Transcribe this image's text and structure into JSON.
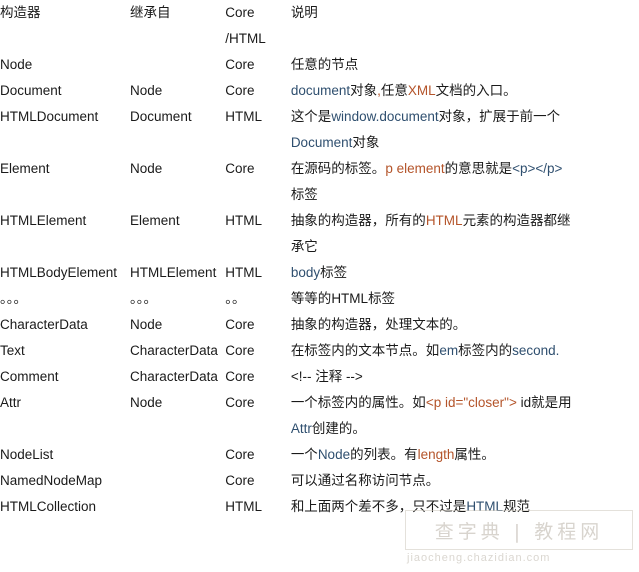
{
  "page": {
    "title": "DOM 构造器继承关系表",
    "background": "#ffffff",
    "text_color": "#1a1a1a",
    "code_blue": "#2f4f6f",
    "code_orange": "#b4542a"
  },
  "table": {
    "headers": {
      "constructor": "构造器",
      "inherits": "继承自",
      "module_line1": "Core",
      "module_line2": "/HTML",
      "description": "说明"
    },
    "rows": [
      {
        "constructor": "Node",
        "inherits": "",
        "module": "Core",
        "desc_lines": [
          [
            {
              "t": "任意的节点",
              "k": "plain"
            }
          ]
        ]
      },
      {
        "constructor": "Document",
        "inherits": "Node",
        "module": "Core",
        "desc_lines": [
          [
            {
              "t": "document",
              "k": "blue"
            },
            {
              "t": "对象",
              "k": "plain"
            },
            {
              "t": ",",
              "k": "orange"
            },
            {
              "t": "任意",
              "k": "plain"
            },
            {
              "t": "XML",
              "k": "orange"
            },
            {
              "t": "文档的入口。",
              "k": "plain"
            }
          ]
        ]
      },
      {
        "constructor": "HTMLDocument",
        "inherits": "Document",
        "module": "HTML",
        "desc_lines": [
          [
            {
              "t": "这个是",
              "k": "plain"
            },
            {
              "t": "window.document",
              "k": "blue"
            },
            {
              "t": "对象，扩展于前一个",
              "k": "plain"
            }
          ],
          [
            {
              "t": "Document",
              "k": "blue"
            },
            {
              "t": "对象",
              "k": "plain"
            }
          ]
        ]
      },
      {
        "constructor": "Element",
        "inherits": "Node",
        "module": "Core",
        "desc_lines": [
          [
            {
              "t": "在源码的标签。",
              "k": "plain"
            },
            {
              "t": "p element",
              "k": "orange"
            },
            {
              "t": "的意思就是",
              "k": "plain"
            },
            {
              "t": "<p></p>",
              "k": "blue"
            }
          ],
          [
            {
              "t": "标签",
              "k": "plain"
            }
          ]
        ]
      },
      {
        "constructor": "HTMLElement",
        "inherits": "Element",
        "module": "HTML",
        "desc_lines": [
          [
            {
              "t": "抽象的构造器，所有的",
              "k": "plain"
            },
            {
              "t": "HTML",
              "k": "orange"
            },
            {
              "t": "元素的构造器都继",
              "k": "plain"
            }
          ],
          [
            {
              "t": "承它",
              "k": "plain"
            }
          ]
        ]
      },
      {
        "constructor": "HTMLBodyElement",
        "inherits": "HTMLElement",
        "module": "HTML",
        "desc_lines": [
          [
            {
              "t": "body",
              "k": "blue"
            },
            {
              "t": "标签",
              "k": "plain"
            }
          ]
        ]
      },
      {
        "constructor": "。。。",
        "inherits": "。。。",
        "module": "。。",
        "desc_lines": [
          [
            {
              "t": "等等的",
              "k": "plain"
            },
            {
              "t": "HTML",
              "k": "plain"
            },
            {
              "t": "标签",
              "k": "plain"
            }
          ]
        ]
      },
      {
        "constructor": "CharacterData",
        "inherits": "Node",
        "module": "Core",
        "desc_lines": [
          [
            {
              "t": "抽象的构造器，处理文本的。",
              "k": "plain"
            }
          ]
        ]
      },
      {
        "constructor": "Text",
        "inherits": "CharacterData",
        "module": "Core",
        "desc_lines": [
          [
            {
              "t": "在标签内的文本节点。如",
              "k": "plain"
            },
            {
              "t": "em",
              "k": "blue"
            },
            {
              "t": "标签内的",
              "k": "plain"
            },
            {
              "t": "second.",
              "k": "blue"
            }
          ]
        ]
      },
      {
        "constructor": "Comment",
        "inherits": "CharacterData",
        "module": "Core",
        "desc_lines": [
          [
            {
              "t": "<!-- 注释 -->",
              "k": "plain"
            }
          ]
        ]
      },
      {
        "constructor": "Attr",
        "inherits": "Node",
        "module": "Core",
        "desc_lines": [
          [
            {
              "t": "一个标签内的属性。如",
              "k": "plain"
            },
            {
              "t": "<p id=\"closer\">",
              "k": "orange"
            },
            {
              "t": " id",
              "k": "plain"
            },
            {
              "t": "就是用",
              "k": "plain"
            }
          ],
          [
            {
              "t": "Attr",
              "k": "blue"
            },
            {
              "t": "创建的。",
              "k": "plain"
            }
          ]
        ]
      },
      {
        "constructor": "NodeList",
        "inherits": "",
        "module": "Core",
        "desc_lines": [
          [
            {
              "t": "一个",
              "k": "plain"
            },
            {
              "t": "Node",
              "k": "blue"
            },
            {
              "t": "的列表。有",
              "k": "plain"
            },
            {
              "t": "length",
              "k": "orange"
            },
            {
              "t": "属性。",
              "k": "plain"
            }
          ]
        ]
      },
      {
        "constructor": "NamedNodeMap",
        "inherits": "",
        "module": "Core",
        "desc_lines": [
          [
            {
              "t": "可以通过名称访问节点。",
              "k": "plain"
            }
          ]
        ]
      },
      {
        "constructor": "HTMLCollection",
        "inherits": "",
        "module": "HTML",
        "desc_lines": [
          [
            {
              "t": "和上面两个差不多，只不过是",
              "k": "plain"
            },
            {
              "t": "HTML",
              "k": "blue"
            },
            {
              "t": "规范",
              "k": "plain"
            }
          ]
        ]
      }
    ]
  },
  "watermark": {
    "main": "查字典 | 教程网",
    "sub": "jiaocheng.chazidian.com"
  }
}
